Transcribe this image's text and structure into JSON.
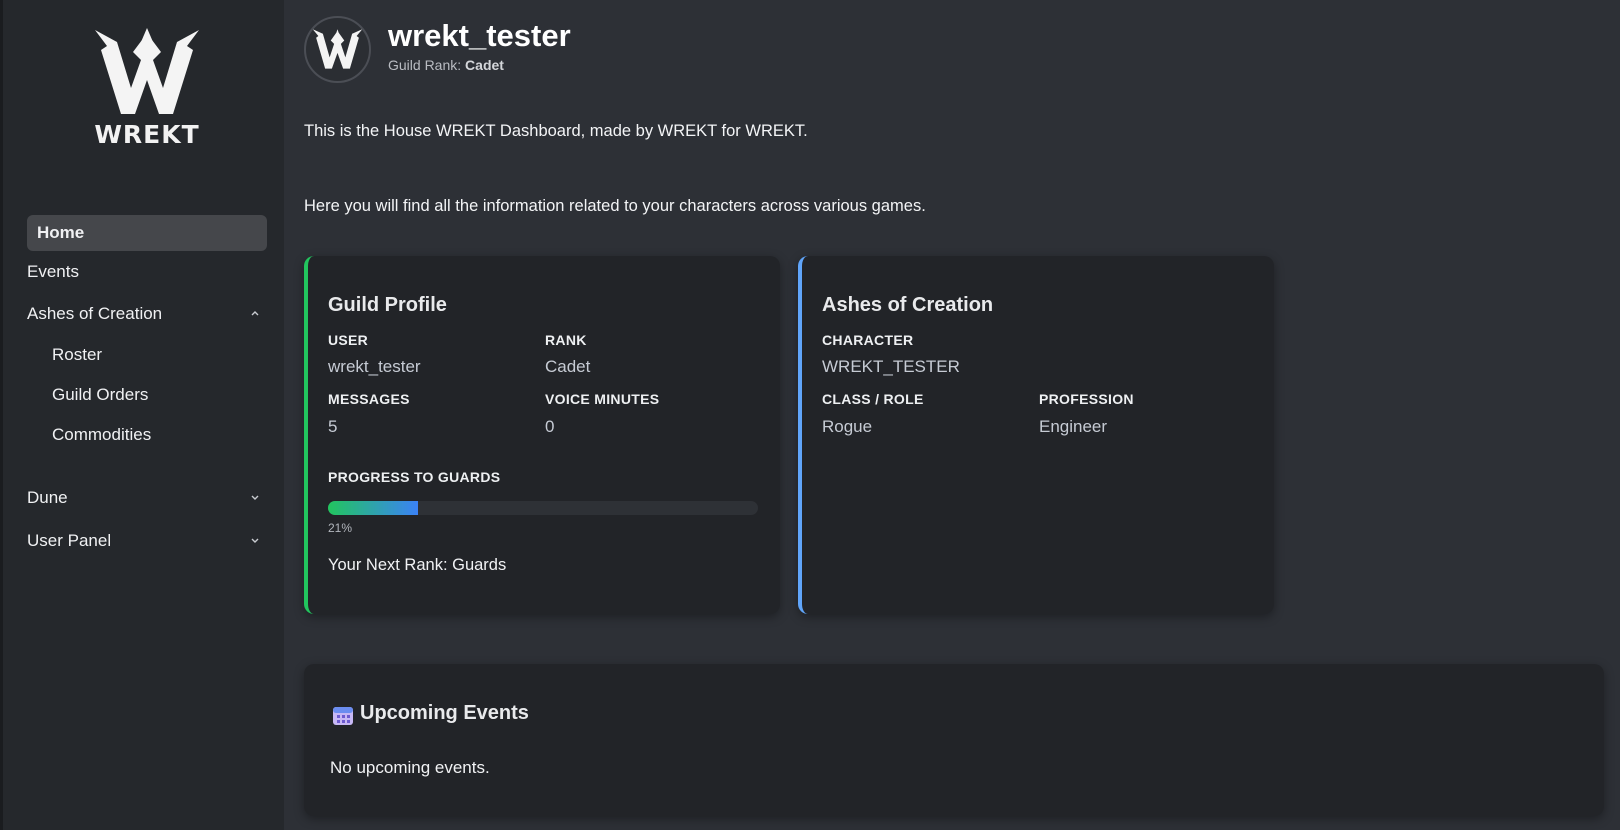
{
  "sidebar": {
    "logo_text": "WREKT",
    "items": [
      {
        "label": "Home",
        "active": true
      },
      {
        "label": "Events"
      },
      {
        "label": "Ashes of Creation",
        "expanded": true,
        "children": [
          "Roster",
          "Guild Orders",
          "Commodities"
        ]
      },
      {
        "label": "Dune",
        "expanded": false
      },
      {
        "label": "User Panel",
        "expanded": false
      }
    ]
  },
  "header": {
    "username": "wrekt_tester",
    "rank_prefix": "Guild Rank:",
    "rank": "Cadet"
  },
  "intro": {
    "line1": "This is the House WREKT Dashboard, made by WREKT for WREKT.",
    "line2": "Here you will find all the information related to your characters across various games."
  },
  "guild_profile": {
    "title": "Guild Profile",
    "user_label": "USER",
    "user_value": "wrekt_tester",
    "rank_label": "RANK",
    "rank_value": "Cadet",
    "messages_label": "MESSAGES",
    "messages_value": "5",
    "voice_label": "VOICE MINUTES",
    "voice_value": "0",
    "progress_label": "PROGRESS TO GUARDS",
    "progress_percent": 21,
    "progress_text": "21%",
    "next_rank_text": "Your Next Rank: Guards"
  },
  "ashes_card": {
    "title": "Ashes of Creation",
    "character_label": "CHARACTER",
    "character_value": "WREKT_TESTER",
    "class_label": "CLASS / ROLE",
    "class_value": "Rogue",
    "profession_label": "PROFESSION",
    "profession_value": "Engineer"
  },
  "events": {
    "title": "Upcoming Events",
    "empty_text": "No upcoming events."
  },
  "colors": {
    "accent_green": "#22c55e",
    "accent_blue": "#60a5fa",
    "background": "#2d3036",
    "sidebar": "#25282c",
    "card": "#222428"
  }
}
